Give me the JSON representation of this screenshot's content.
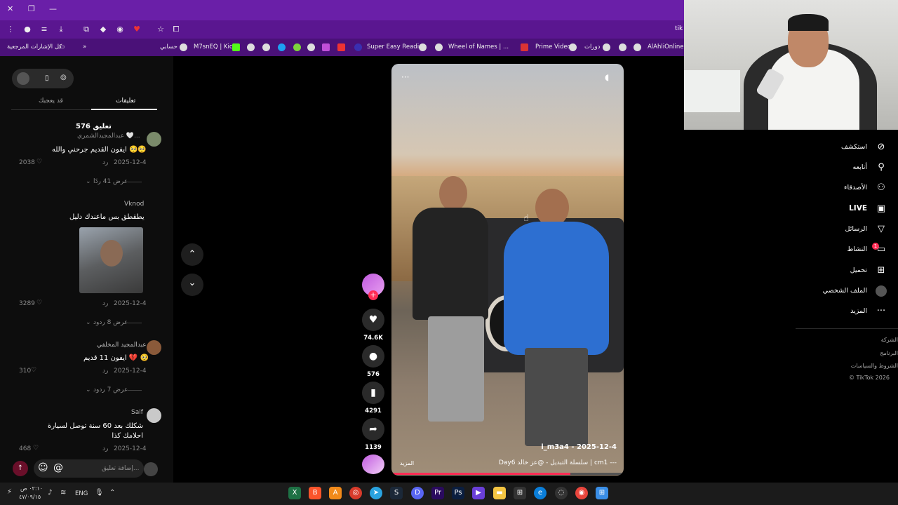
{
  "browser": {
    "url_fragment": "tik",
    "bookmarks": [
      {
        "label": "كل الإشارات المرجعية"
      },
      {
        "label": "حسابي"
      },
      {
        "label": "M7snEQ | Kick"
      },
      {
        "label": "Super Easy Reading"
      },
      {
        "label": "Wheel of Names | ..."
      },
      {
        "label": "Prime Video"
      },
      {
        "label": "دورات"
      },
      {
        "label": "AlAhliOnline"
      }
    ]
  },
  "comments_panel": {
    "tabs": {
      "comments": "تعليقات",
      "you_may_like": "قد يعجبك"
    },
    "count_title": "576 تعليق",
    "comments": [
      {
        "user": "عبدالمجيدالشمري 🤍...",
        "text": "ايفون القديم جرحني والله 🥺🥺",
        "date": "2025-12-4",
        "reply": "رد",
        "likes": "2038",
        "view_replies": "عرض 41 ردًا"
      },
      {
        "user": "Vknod",
        "text": "يطقطق بس ماعندك دليل",
        "date": "2025-12-4",
        "reply": "رد",
        "likes": "3289",
        "view_replies": "عرض 8 ردود"
      },
      {
        "user": "عبدالمجيد المخلفي",
        "text": "ايفون 11 قديم 💔 🥺",
        "date": "2025-12-4",
        "reply": "رد",
        "likes": "310",
        "view_replies": "عرض 7 ردود"
      },
      {
        "user": "Saif",
        "text": "شكلك بعد 60 سنة توصل لسيارة احلامك كذا",
        "date": "2025-12-4",
        "reply": "رد",
        "likes": "468"
      }
    ],
    "input_placeholder": "إضافة تعليق..."
  },
  "video": {
    "author_line": "i_m3a4 - 2025-12-4",
    "caption": "Day6 سلسلة التبديل - @عز خالد | cm1 ---",
    "more": "المزيد",
    "progress": 0.77
  },
  "actions": {
    "likes": "74.6K",
    "comments": "576",
    "saves": "4291",
    "shares": "1139"
  },
  "nav": [
    {
      "label": "استكشف",
      "icon": "compass-icon"
    },
    {
      "label": "أتابعه",
      "icon": "user-plus-icon"
    },
    {
      "label": "الأصدقاء",
      "icon": "friends-icon"
    },
    {
      "label": "LIVE",
      "icon": "live-icon"
    },
    {
      "label": "الرسائل",
      "icon": "send-icon"
    },
    {
      "label": "النشاط",
      "icon": "activity-icon",
      "badge": "1"
    },
    {
      "label": "تحميل",
      "icon": "upload-icon"
    },
    {
      "label": "الملف الشخصي",
      "icon": "avatar-icon"
    },
    {
      "label": "المزيد",
      "icon": "more-icon"
    }
  ],
  "footer": {
    "company": "الشركة",
    "program": "البرنامج",
    "terms": "الشروط والسياسات",
    "copyright": "© TikTok 2026"
  },
  "taskbar": {
    "time": "٠٢:١٠ ص",
    "date": "٤٧/٠٩/١٥",
    "lang": "ENG"
  }
}
